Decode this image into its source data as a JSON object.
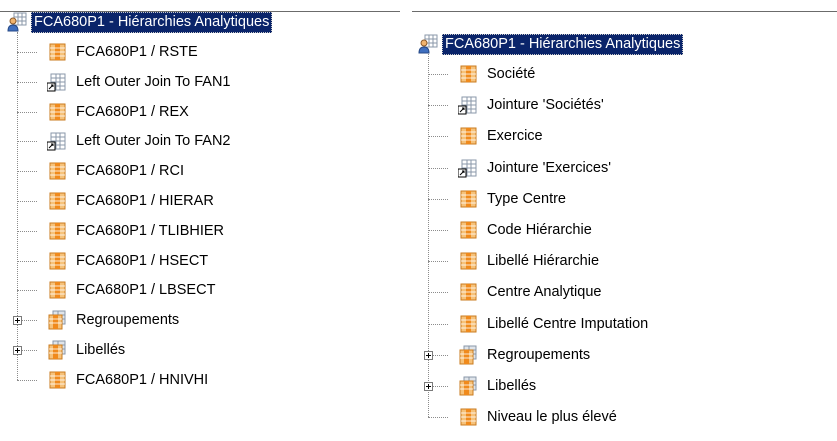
{
  "left_tree": {
    "root": {
      "label": "FCA680P1 - Hiérarchies Analytiques",
      "icon": "user-table-icon"
    },
    "items": [
      {
        "label": "FCA680P1 / RSTE",
        "icon": "column-table-icon",
        "expandable": false
      },
      {
        "label": "Left Outer Join To FAN1",
        "icon": "join-shortcut-icon",
        "expandable": false
      },
      {
        "label": "FCA680P1 / REX",
        "icon": "column-table-icon",
        "expandable": false
      },
      {
        "label": "Left Outer Join To FAN2",
        "icon": "join-shortcut-icon",
        "expandable": false
      },
      {
        "label": "FCA680P1 / RCI",
        "icon": "column-table-icon",
        "expandable": false
      },
      {
        "label": "FCA680P1 / HIERAR",
        "icon": "column-table-icon",
        "expandable": false
      },
      {
        "label": "FCA680P1 / TLIBHIER",
        "icon": "column-table-icon",
        "expandable": false
      },
      {
        "label": "FCA680P1 / HSECT",
        "icon": "column-table-icon",
        "expandable": false
      },
      {
        "label": "FCA680P1 / LBSECT",
        "icon": "column-table-icon",
        "expandable": false
      },
      {
        "label": "Regroupements",
        "icon": "folder-table-icon",
        "expandable": true
      },
      {
        "label": "Libellés",
        "icon": "folder-table-icon",
        "expandable": true
      },
      {
        "label": "FCA680P1 / HNIVHI",
        "icon": "column-table-icon",
        "expandable": false
      }
    ]
  },
  "right_tree": {
    "root": {
      "label": "FCA680P1 - Hiérarchies Analytiques",
      "icon": "user-table-icon"
    },
    "items": [
      {
        "label": "Société",
        "icon": "column-table-icon",
        "expandable": false
      },
      {
        "label": "Jointure 'Sociétés'",
        "icon": "join-shortcut-icon",
        "expandable": false
      },
      {
        "label": "Exercice",
        "icon": "column-table-icon",
        "expandable": false
      },
      {
        "label": "Jointure 'Exercices'",
        "icon": "join-shortcut-icon",
        "expandable": false
      },
      {
        "label": "Type Centre",
        "icon": "column-table-icon",
        "expandable": false
      },
      {
        "label": "Code Hiérarchie",
        "icon": "column-table-icon",
        "expandable": false
      },
      {
        "label": "Libellé Hiérarchie",
        "icon": "column-table-icon",
        "expandable": false
      },
      {
        "label": "Centre Analytique",
        "icon": "column-table-icon",
        "expandable": false
      },
      {
        "label": "Libellé Centre Imputation",
        "icon": "column-table-icon",
        "expandable": false
      },
      {
        "label": "Regroupements",
        "icon": "folder-table-icon",
        "expandable": true
      },
      {
        "label": "Libellés",
        "icon": "folder-table-icon",
        "expandable": true
      },
      {
        "label": "Niveau le plus élevé",
        "icon": "column-table-icon",
        "expandable": false
      }
    ]
  },
  "colors": {
    "selection_background": "#0a246a",
    "selection_text": "#ffffff",
    "connector": "#8c8c8c",
    "icon_orange": "#f0a040",
    "icon_grid": "#9aa7b8"
  }
}
